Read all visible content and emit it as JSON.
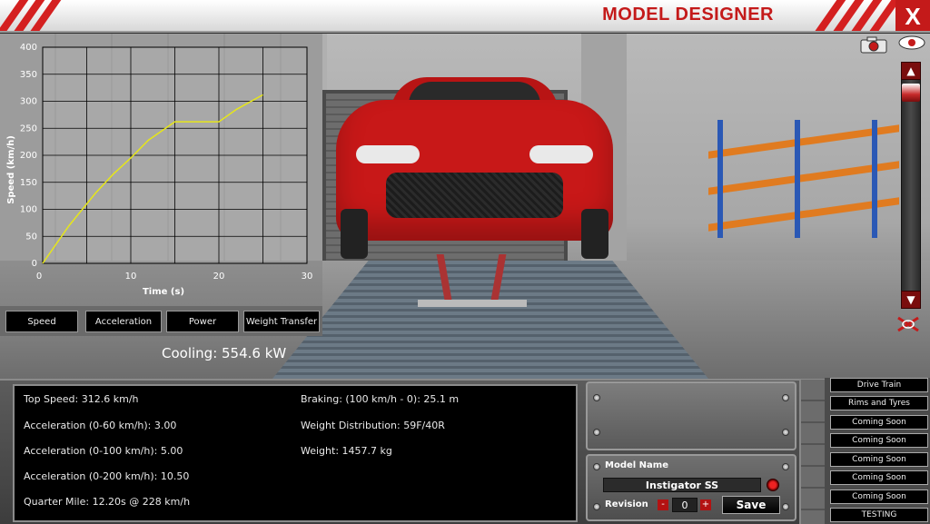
{
  "header": {
    "title": "MODEL DESIGNER",
    "close_label": "X"
  },
  "graph": {
    "tabs": [
      "Speed",
      "Acceleration",
      "Power",
      "Weight Transfer"
    ],
    "selected_tab": "Speed"
  },
  "chart_data": {
    "type": "line",
    "title": "",
    "xlabel": "Time (s)",
    "ylabel": "Speed (km/h)",
    "xlim": [
      0,
      30
    ],
    "ylim": [
      0,
      400
    ],
    "x_ticks": [
      "0",
      "10",
      "20",
      "30"
    ],
    "y_ticks": [
      "0",
      "50",
      "100",
      "150",
      "200",
      "250",
      "300",
      "350",
      "400"
    ],
    "grid": true,
    "series": [
      {
        "color": "#e6e61a",
        "x": [
          0,
          3,
          6,
          8,
          10,
          12,
          15,
          18,
          20,
          22,
          25
        ],
        "y": [
          0,
          70,
          130,
          165,
          195,
          228,
          262,
          262,
          262,
          285,
          312
        ]
      }
    ]
  },
  "cooling": "Cooling: 554.6 kW",
  "stats": {
    "top_speed": "Top Speed: 312.6 km/h",
    "accel_60": "Acceleration (0-60 km/h): 3.00",
    "accel_100": "Acceleration (0-100 km/h): 5.00",
    "accel_200": "Acceleration (0-200 km/h): 10.50",
    "quarter_mile": "Quarter Mile: 12.20s @ 228 km/h",
    "braking": "Braking: (100 km/h - 0): 25.1 m",
    "weight_distribution": "Weight Distribution: 59F/40R",
    "weight": "Weight: 1457.7 kg"
  },
  "model": {
    "name_label": "Model Name",
    "name_value": "Instigator SS",
    "revision_label": "Revision",
    "revision_value": "0",
    "minus_label": "-",
    "plus_label": "+",
    "save_label": "Save"
  },
  "side_menu": [
    "Drive Train",
    "Rims and Tyres",
    "Coming Soon",
    "Coming Soon",
    "Coming Soon",
    "Coming Soon",
    "Coming Soon",
    "TESTING"
  ],
  "zoom": {
    "up_label": "▲",
    "down_label": "▼"
  },
  "colors": {
    "accent": "#c41a1a",
    "plot_line": "#e6e61a",
    "panel_bg": "#000000"
  }
}
